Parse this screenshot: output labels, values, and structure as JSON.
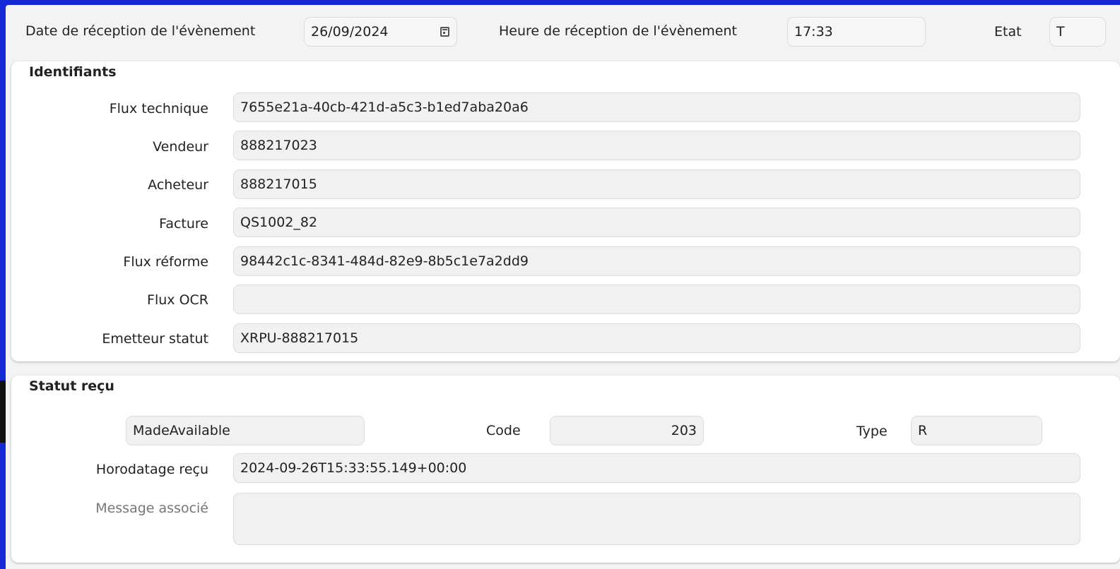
{
  "header": {
    "date_label": "Date de réception de l'évènement",
    "date_value": "26/09/2024",
    "time_label": "Heure de réception de l'évènement",
    "time_value": "17:33",
    "state_label": "Etat",
    "state_value": "T"
  },
  "identifiants": {
    "title": "Identifiants",
    "fields": [
      {
        "label": "Flux technique",
        "value": "7655e21a-40cb-421d-a5c3-b1ed7aba20a6"
      },
      {
        "label": "Vendeur",
        "value": "888217023"
      },
      {
        "label": "Acheteur",
        "value": "888217015"
      },
      {
        "label": "Facture",
        "value": "QS1002_82"
      },
      {
        "label": "Flux réforme",
        "value": "98442c1c-8341-484d-82e9-8b5c1e7a2dd9"
      },
      {
        "label": "Flux OCR",
        "value": ""
      },
      {
        "label": "Emetteur statut",
        "value": "XRPU-888217015"
      }
    ]
  },
  "statut": {
    "title": "Statut reçu",
    "status_value": "MadeAvailable",
    "code_label": "Code",
    "code_value": "203",
    "type_label": "Type",
    "type_value": "R",
    "timestamp_label": "Horodatage reçu",
    "timestamp_value": "2024-09-26T15:33:55.149+00:00",
    "message_label": "Message associé",
    "message_value": ""
  },
  "icons": {
    "date_picker": "calendar-icon"
  },
  "colors": {
    "background": "#1528d6",
    "panel": "#ffffff",
    "field": "#f1f1f1"
  }
}
